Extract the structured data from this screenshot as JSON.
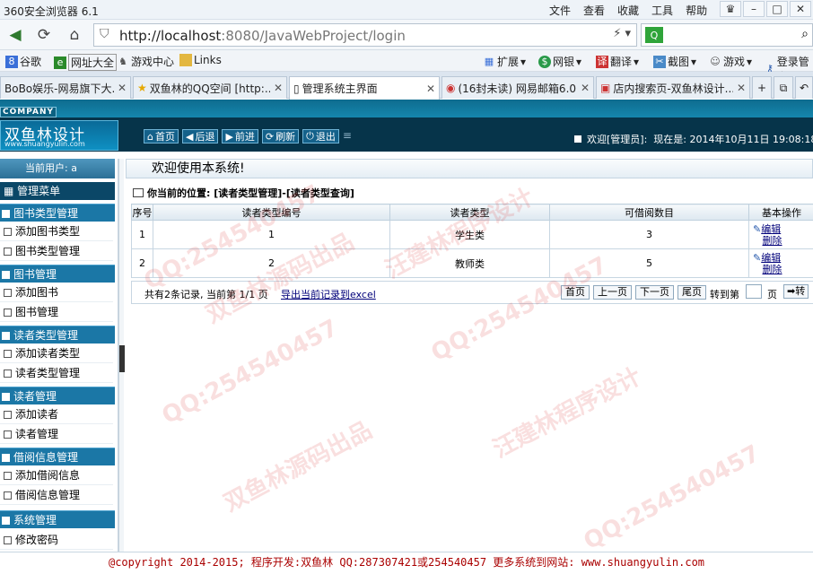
{
  "browser": {
    "title": "360安全浏览器 6.1",
    "menus": [
      "文件",
      "查看",
      "收藏",
      "工具",
      "帮助"
    ],
    "url_host": "http://localhost",
    "url_rest": ":8080/JavaWebProject/login",
    "tabs": [
      "BoBo娱乐-网易旗下大...",
      "双鱼林的QQ空间 [http:...",
      "管理系统主界面",
      "(16封未读) 网易邮箱6.0...",
      "店内搜索页-双鱼林设计..."
    ]
  },
  "favorites": [
    "谷歌",
    "网址大全",
    "游戏中心",
    "Links"
  ],
  "favorites_right": [
    "扩展",
    "网银",
    "翻译",
    "截图",
    "游戏",
    "登录管家"
  ],
  "page": {
    "company": "COMPANY",
    "logo_text": "双鱼林设计",
    "logo_url": "www.shuangyulin.com",
    "toolbar": [
      "首页",
      "后退",
      "前进",
      "刷新",
      "退出"
    ],
    "user_label": "欢迎[管理员]:",
    "now_label": "现在是: 2014年10月11日 19:08:18",
    "current_user": "当前用户: a",
    "menu_title": "管理菜单",
    "groups": [
      {
        "title": "图书类型管理",
        "items": [
          "添加图书类型",
          "图书类型管理"
        ]
      },
      {
        "title": "图书管理",
        "items": [
          "添加图书",
          "图书管理"
        ]
      },
      {
        "title": "读者类型管理",
        "items": [
          "添加读者类型",
          "读者类型管理"
        ]
      },
      {
        "title": "读者管理",
        "items": [
          "添加读者",
          "读者管理"
        ]
      },
      {
        "title": "借阅信息管理",
        "items": [
          "添加借阅信息",
          "借阅信息管理"
        ]
      }
    ],
    "system_group": "系统管理",
    "system_item": "修改密码",
    "welcome": "欢迎使用本系统!",
    "location": "你当前的位置: [读者类型管理]-[读者类型查询]",
    "table": {
      "headers": [
        "序号",
        "读者类型编号",
        "读者类型",
        "可借阅数目",
        "基本操作"
      ],
      "rows": [
        {
          "no": "1",
          "id": "1",
          "type": "学生类",
          "count": "3",
          "edit": "编辑",
          "del": "删除"
        },
        {
          "no": "2",
          "id": "2",
          "type": "教师类",
          "count": "5",
          "edit": "编辑",
          "del": "删除"
        }
      ]
    },
    "pager": {
      "info": "共有2条记录, 当前第 1/1 页",
      "export": "导出当前记录到excel",
      "buttons": [
        "首页",
        "上一页",
        "下一页",
        "尾页"
      ],
      "goto": "转到第",
      "page": "页",
      "go": "转"
    },
    "footer": "@copyright 2014-2015; 程序开发:双鱼林  QQ:287307421或254540457  更多系统到网站: www.shuangyulin.com"
  },
  "watermarks": [
    "QQ:254540457",
    "汪建林程序设计",
    "双鱼林源码出品"
  ]
}
